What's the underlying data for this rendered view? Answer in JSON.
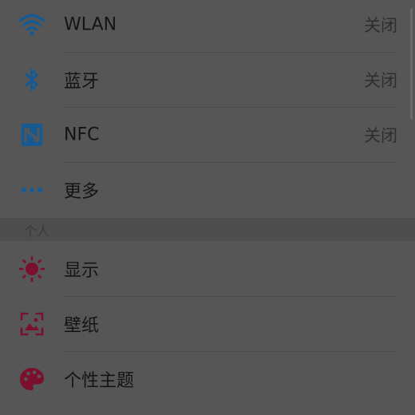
{
  "colors": {
    "background": "#565656",
    "connectivity_icon": "#155a93",
    "personal_icon": "#7a0f2e",
    "label_text": "#141414",
    "value_text": "#2e2e2e"
  },
  "connectivity": {
    "items": [
      {
        "icon": "wifi-icon",
        "label": "WLAN",
        "value": "关闭"
      },
      {
        "icon": "bluetooth-icon",
        "label": "蓝牙",
        "value": "关闭"
      },
      {
        "icon": "nfc-icon",
        "label": "NFC",
        "value": "关闭"
      },
      {
        "icon": "more-dots-icon",
        "label": "更多"
      }
    ]
  },
  "personal": {
    "header": "个人",
    "items": [
      {
        "icon": "brightness-icon",
        "label": "显示"
      },
      {
        "icon": "wallpaper-icon",
        "label": "壁纸"
      },
      {
        "icon": "palette-icon",
        "label": "个性主题"
      }
    ]
  }
}
